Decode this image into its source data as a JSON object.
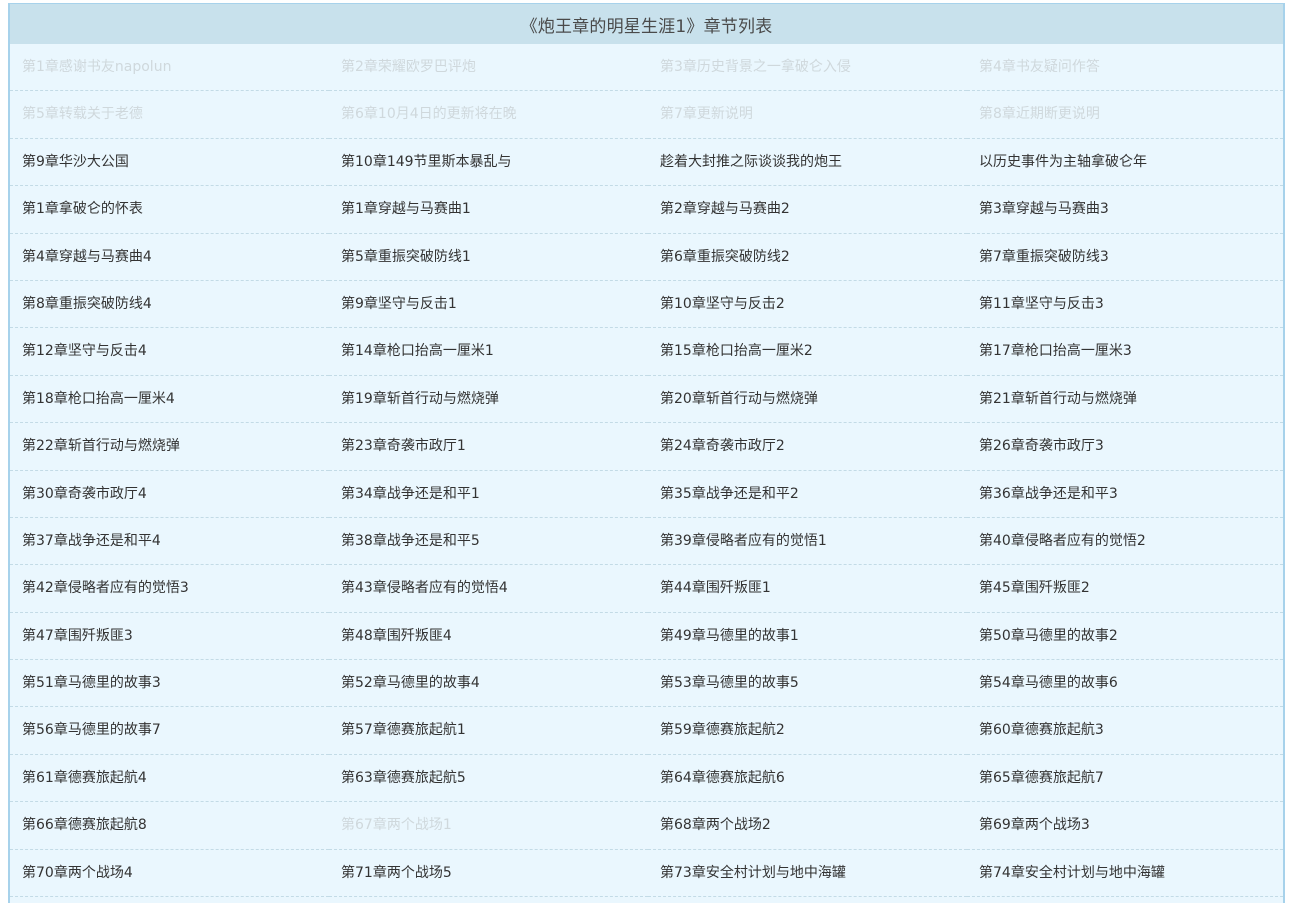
{
  "header": {
    "title": "《炮王章的明星生涯1》章节列表"
  },
  "colors": {
    "panel_bg": "#eaf7fe",
    "header_bg": "#c8e1ec",
    "border": "#a7d2eb",
    "link_text": "#333333",
    "read_link_text": "#cfd8dc"
  },
  "chapters": [
    {
      "label": "第1章感谢书友napolun",
      "read": true
    },
    {
      "label": "第2章荣耀欧罗巴评炮",
      "read": true
    },
    {
      "label": "第3章历史背景之一拿破仑入侵",
      "read": true
    },
    {
      "label": "第4章书友疑问作答",
      "read": true
    },
    {
      "label": "第5章转载关于老德",
      "read": true
    },
    {
      "label": "第6章10月4日的更新将在晚",
      "read": true
    },
    {
      "label": "第7章更新说明",
      "read": true
    },
    {
      "label": "第8章近期断更说明",
      "read": true
    },
    {
      "label": "第9章华沙大公国",
      "read": false
    },
    {
      "label": "第10章149节里斯本暴乱与",
      "read": false
    },
    {
      "label": "趁着大封推之际谈谈我的炮王",
      "read": false
    },
    {
      "label": "以历史事件为主轴拿破仑年",
      "read": false
    },
    {
      "label": "第1章拿破仑的怀表",
      "read": false
    },
    {
      "label": "第1章穿越与马赛曲1",
      "read": false
    },
    {
      "label": "第2章穿越与马赛曲2",
      "read": false
    },
    {
      "label": "第3章穿越与马赛曲3",
      "read": false
    },
    {
      "label": "第4章穿越与马赛曲4",
      "read": false
    },
    {
      "label": "第5章重振突破防线1",
      "read": false
    },
    {
      "label": "第6章重振突破防线2",
      "read": false
    },
    {
      "label": "第7章重振突破防线3",
      "read": false
    },
    {
      "label": "第8章重振突破防线4",
      "read": false
    },
    {
      "label": "第9章坚守与反击1",
      "read": false
    },
    {
      "label": "第10章坚守与反击2",
      "read": false
    },
    {
      "label": "第11章坚守与反击3",
      "read": false
    },
    {
      "label": "第12章坚守与反击4",
      "read": false
    },
    {
      "label": "第14章枪口抬高一厘米1",
      "read": false
    },
    {
      "label": "第15章枪口抬高一厘米2",
      "read": false
    },
    {
      "label": "第17章枪口抬高一厘米3",
      "read": false
    },
    {
      "label": "第18章枪口抬高一厘米4",
      "read": false
    },
    {
      "label": "第19章斩首行动与燃烧弹",
      "read": false
    },
    {
      "label": "第20章斩首行动与燃烧弹",
      "read": false
    },
    {
      "label": "第21章斩首行动与燃烧弹",
      "read": false
    },
    {
      "label": "第22章斩首行动与燃烧弹",
      "read": false
    },
    {
      "label": "第23章奇袭市政厅1",
      "read": false
    },
    {
      "label": "第24章奇袭市政厅2",
      "read": false
    },
    {
      "label": "第26章奇袭市政厅3",
      "read": false
    },
    {
      "label": "第30章奇袭市政厅4",
      "read": false
    },
    {
      "label": "第34章战争还是和平1",
      "read": false
    },
    {
      "label": "第35章战争还是和平2",
      "read": false
    },
    {
      "label": "第36章战争还是和平3",
      "read": false
    },
    {
      "label": "第37章战争还是和平4",
      "read": false
    },
    {
      "label": "第38章战争还是和平5",
      "read": false
    },
    {
      "label": "第39章侵略者应有的觉悟1",
      "read": false
    },
    {
      "label": "第40章侵略者应有的觉悟2",
      "read": false
    },
    {
      "label": "第42章侵略者应有的觉悟3",
      "read": false
    },
    {
      "label": "第43章侵略者应有的觉悟4",
      "read": false
    },
    {
      "label": "第44章围歼叛匪1",
      "read": false
    },
    {
      "label": "第45章围歼叛匪2",
      "read": false
    },
    {
      "label": "第47章围歼叛匪3",
      "read": false
    },
    {
      "label": "第48章围歼叛匪4",
      "read": false
    },
    {
      "label": "第49章马德里的故事1",
      "read": false
    },
    {
      "label": "第50章马德里的故事2",
      "read": false
    },
    {
      "label": "第51章马德里的故事3",
      "read": false
    },
    {
      "label": "第52章马德里的故事4",
      "read": false
    },
    {
      "label": "第53章马德里的故事5",
      "read": false
    },
    {
      "label": "第54章马德里的故事6",
      "read": false
    },
    {
      "label": "第56章马德里的故事7",
      "read": false
    },
    {
      "label": "第57章德赛旅起航1",
      "read": false
    },
    {
      "label": "第59章德赛旅起航2",
      "read": false
    },
    {
      "label": "第60章德赛旅起航3",
      "read": false
    },
    {
      "label": "第61章德赛旅起航4",
      "read": false
    },
    {
      "label": "第63章德赛旅起航5",
      "read": false
    },
    {
      "label": "第64章德赛旅起航6",
      "read": false
    },
    {
      "label": "第65章德赛旅起航7",
      "read": false
    },
    {
      "label": "第66章德赛旅起航8",
      "read": false
    },
    {
      "label": "第67章两个战场1",
      "read": true
    },
    {
      "label": "第68章两个战场2",
      "read": false
    },
    {
      "label": "第69章两个战场3",
      "read": false
    },
    {
      "label": "第70章两个战场4",
      "read": false
    },
    {
      "label": "第71章两个战场5",
      "read": false
    },
    {
      "label": "第73章安全村计划与地中海罐",
      "read": false
    },
    {
      "label": "第74章安全村计划与地中海罐",
      "read": false
    }
  ]
}
